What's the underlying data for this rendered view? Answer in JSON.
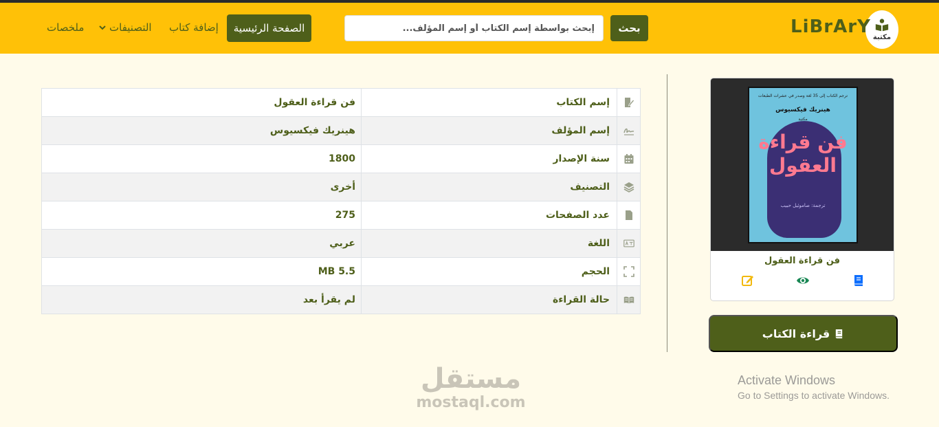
{
  "navbar": {
    "logo_label": "مكتبة",
    "brand": "LiBrArY",
    "search_button": "بحث",
    "search_placeholder": "إبحث بواسطة إسم الكتاب أو إسم المؤلف...",
    "nav_home": "الصفحة الرئيسية",
    "nav_add_book": "إضافة كتاب",
    "nav_categories": "التصنيفات",
    "nav_summaries": "ملخصات"
  },
  "details": {
    "rows": [
      {
        "icon": "edit-document-icon",
        "label": "إسم الكتاب",
        "value": "فن قراءة العقول"
      },
      {
        "icon": "signature-icon",
        "label": "إسم المؤلف",
        "value": "هينريك فيكسيوس"
      },
      {
        "icon": "calendar-icon",
        "label": "سنة الإصدار",
        "value": "1800"
      },
      {
        "icon": "layers-icon",
        "label": "التصنيف",
        "value": "أخرى"
      },
      {
        "icon": "file-icon",
        "label": "عدد الصفحات",
        "value": "275"
      },
      {
        "icon": "language-icon",
        "label": "اللغة",
        "value": "عربي"
      },
      {
        "icon": "expand-icon",
        "label": "الحجم",
        "value": "5.5 MB"
      },
      {
        "icon": "open-book-icon",
        "label": "حالة القراءة",
        "value": "لم يقرأ بعد"
      }
    ]
  },
  "book_card": {
    "cover": {
      "top_line": "ترجم الكتاب إلى 35 لغة وصدر في عشرات الطبعات",
      "author": "هينريك فيكسيوس",
      "publisher": "مكتبة",
      "title": "فن قراءة العقول",
      "translator": "ترجمة: صاموئيل حبيب"
    },
    "title": "فن قراءة العقول",
    "colors": {
      "edit": "#f2b90f",
      "view": "#198754",
      "read": "#0d6efd"
    }
  },
  "read_button": "قراءة الكتاب",
  "watermark": {
    "arabic": "مستقل",
    "latin": "mostaql.com"
  },
  "windows_notice": {
    "title": "Activate Windows",
    "subtitle": "Go to Settings to activate Windows."
  },
  "colors": {
    "navbar": "#ffc107",
    "accent": "#4e5f1a",
    "page_bg": "#fffbea"
  }
}
